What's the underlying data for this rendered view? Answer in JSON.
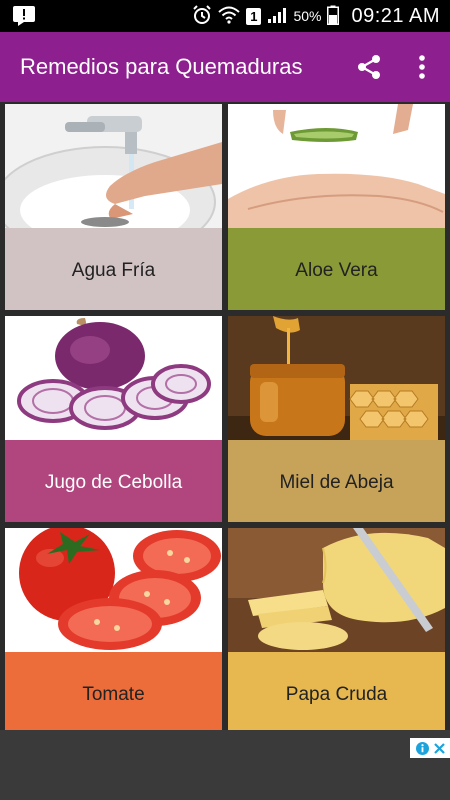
{
  "status_bar": {
    "battery": "50%",
    "time": "09:21 AM",
    "sim": "1"
  },
  "app_bar": {
    "title": "Remedios para Quemaduras",
    "share_icon": "share-icon",
    "more_icon": "more-vert-icon"
  },
  "remedies": [
    {
      "label": "Agua Fría",
      "color": "#d1c3c4",
      "text_color": "#222222"
    },
    {
      "label": "Aloe Vera",
      "color": "#8a9a37",
      "text_color": "#222222"
    },
    {
      "label": "Jugo de Cebolla",
      "color": "#b1457e",
      "text_color": "#ffffff"
    },
    {
      "label": "Miel de Abeja",
      "color": "#c7a35a",
      "text_color": "#222222"
    },
    {
      "label": "Tomate",
      "color": "#ed6d3a",
      "text_color": "#222222"
    },
    {
      "label": "Papa Cruda",
      "color": "#e7b84f",
      "text_color": "#222222"
    }
  ],
  "ad": {
    "close_icon": "close-icon",
    "info_icon": "info-icon"
  },
  "colors": {
    "app_bar": "#8e1f8f",
    "background": "#2b2b2b"
  }
}
